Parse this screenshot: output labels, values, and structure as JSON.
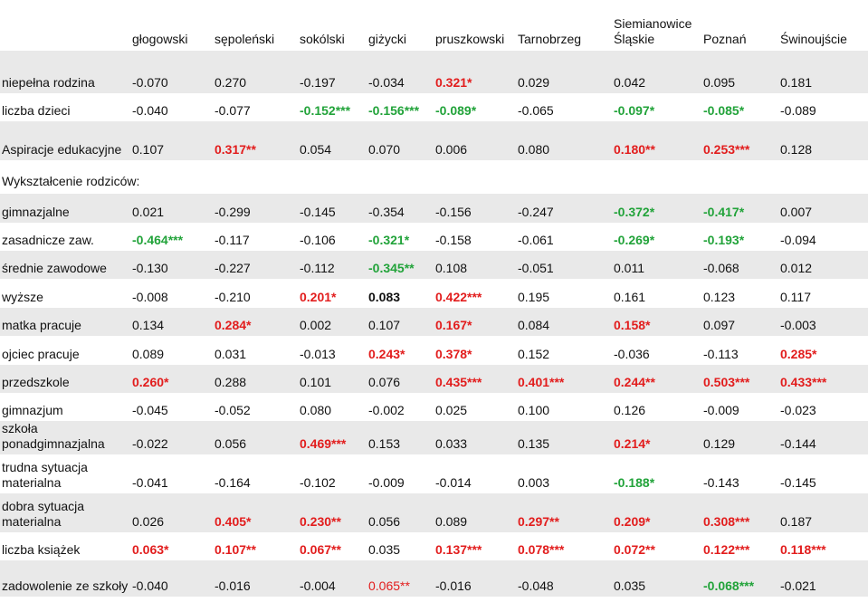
{
  "columns": [
    "",
    "głogowski",
    "sępoleński",
    "sokólski",
    "giżycki",
    "pruszkowski",
    "Tarnobrzeg",
    "Siemianowice Śląskie",
    "Poznań",
    "Świnoujście"
  ],
  "rows": [
    {
      "label": "niepełna rodzina",
      "cells": [
        {
          "v": "-0.070"
        },
        {
          "v": "0.270"
        },
        {
          "v": "-0.197"
        },
        {
          "v": "-0.034"
        },
        {
          "v": "0.321*",
          "s": "red"
        },
        {
          "v": "0.029"
        },
        {
          "v": "0.042"
        },
        {
          "v": "0.095"
        },
        {
          "v": "0.181"
        }
      ]
    },
    {
      "label": "liczba dzieci",
      "cells": [
        {
          "v": "-0.040"
        },
        {
          "v": "-0.077"
        },
        {
          "v": "-0.152***",
          "s": "green"
        },
        {
          "v": "-0.156***",
          "s": "green"
        },
        {
          "v": "-0.089*",
          "s": "green"
        },
        {
          "v": "-0.065"
        },
        {
          "v": "-0.097*",
          "s": "green"
        },
        {
          "v": "-0.085*",
          "s": "green"
        },
        {
          "v": "-0.089"
        }
      ]
    },
    {
      "label": "Aspiracje edukacyjne",
      "cells": [
        {
          "v": "0.107"
        },
        {
          "v": "0.317**",
          "s": "red"
        },
        {
          "v": "0.054"
        },
        {
          "v": "0.070"
        },
        {
          "v": "0.006"
        },
        {
          "v": "0.080"
        },
        {
          "v": "0.180**",
          "s": "red"
        },
        {
          "v": "0.253***",
          "s": "red"
        },
        {
          "v": "0.128"
        }
      ]
    },
    {
      "label": "Wykształcenie rodziców:",
      "cells": []
    },
    {
      "label": "gimnazjalne",
      "cells": [
        {
          "v": "0.021"
        },
        {
          "v": "-0.299"
        },
        {
          "v": "-0.145"
        },
        {
          "v": "-0.354"
        },
        {
          "v": "-0.156"
        },
        {
          "v": "-0.247"
        },
        {
          "v": "-0.372*",
          "s": "green"
        },
        {
          "v": "-0.417*",
          "s": "green"
        },
        {
          "v": "0.007"
        }
      ]
    },
    {
      "label": "zasadnicze zaw.",
      "cells": [
        {
          "v": "-0.464***",
          "s": "green"
        },
        {
          "v": "-0.117"
        },
        {
          "v": "-0.106"
        },
        {
          "v": "-0.321*",
          "s": "green"
        },
        {
          "v": "-0.158"
        },
        {
          "v": "-0.061"
        },
        {
          "v": "-0.269*",
          "s": "green"
        },
        {
          "v": "-0.193*",
          "s": "green"
        },
        {
          "v": "-0.094"
        }
      ]
    },
    {
      "label": "średnie zawodowe",
      "cells": [
        {
          "v": "-0.130"
        },
        {
          "v": "-0.227"
        },
        {
          "v": "-0.112"
        },
        {
          "v": "-0.345**",
          "s": "green"
        },
        {
          "v": "0.108"
        },
        {
          "v": "-0.051"
        },
        {
          "v": "0.011"
        },
        {
          "v": "-0.068"
        },
        {
          "v": "0.012"
        }
      ]
    },
    {
      "label": "wyższe",
      "cells": [
        {
          "v": "-0.008"
        },
        {
          "v": "-0.210"
        },
        {
          "v": "0.201*",
          "s": "red"
        },
        {
          "v": "0.083",
          "s": "bold"
        },
        {
          "v": "0.422***",
          "s": "red"
        },
        {
          "v": "0.195"
        },
        {
          "v": "0.161"
        },
        {
          "v": "0.123"
        },
        {
          "v": "0.117"
        }
      ]
    },
    {
      "label": "matka pracuje",
      "cells": [
        {
          "v": "0.134"
        },
        {
          "v": "0.284*",
          "s": "red"
        },
        {
          "v": "0.002"
        },
        {
          "v": "0.107"
        },
        {
          "v": "0.167*",
          "s": "red"
        },
        {
          "v": "0.084"
        },
        {
          "v": "0.158*",
          "s": "red"
        },
        {
          "v": "0.097"
        },
        {
          "v": "-0.003"
        }
      ]
    },
    {
      "label": "ojciec pracuje",
      "cells": [
        {
          "v": "0.089"
        },
        {
          "v": "0.031"
        },
        {
          "v": "-0.013"
        },
        {
          "v": "0.243*",
          "s": "red"
        },
        {
          "v": "0.378*",
          "s": "red"
        },
        {
          "v": "0.152"
        },
        {
          "v": "-0.036"
        },
        {
          "v": "-0.113"
        },
        {
          "v": "0.285*",
          "s": "red"
        }
      ]
    },
    {
      "label": "przedszkole",
      "cells": [
        {
          "v": "0.260*",
          "s": "red"
        },
        {
          "v": "0.288"
        },
        {
          "v": "0.101"
        },
        {
          "v": "0.076"
        },
        {
          "v": "0.435***",
          "s": "red"
        },
        {
          "v": "0.401***",
          "s": "red"
        },
        {
          "v": "0.244**",
          "s": "red"
        },
        {
          "v": "0.503***",
          "s": "red"
        },
        {
          "v": "0.433***",
          "s": "red"
        }
      ]
    },
    {
      "label": "gimnazjum",
      "cells": [
        {
          "v": "-0.045"
        },
        {
          "v": "-0.052"
        },
        {
          "v": "0.080"
        },
        {
          "v": "-0.002"
        },
        {
          "v": "0.025"
        },
        {
          "v": "0.100"
        },
        {
          "v": "0.126"
        },
        {
          "v": "-0.009"
        },
        {
          "v": "-0.023"
        }
      ]
    },
    {
      "label": "szkoła ponadgimnazjalna",
      "cells": [
        {
          "v": "-0.022"
        },
        {
          "v": "0.056"
        },
        {
          "v": "0.469***",
          "s": "red"
        },
        {
          "v": "0.153"
        },
        {
          "v": "0.033"
        },
        {
          "v": "0.135"
        },
        {
          "v": "0.214*",
          "s": "red"
        },
        {
          "v": "0.129"
        },
        {
          "v": "-0.144"
        }
      ]
    },
    {
      "label": "trudna sytuacja materialna",
      "cells": [
        {
          "v": "-0.041"
        },
        {
          "v": "-0.164"
        },
        {
          "v": "-0.102"
        },
        {
          "v": "-0.009"
        },
        {
          "v": "-0.014"
        },
        {
          "v": "0.003"
        },
        {
          "v": "-0.188*",
          "s": "green"
        },
        {
          "v": "-0.143"
        },
        {
          "v": "-0.145"
        }
      ]
    },
    {
      "label": "dobra sytuacja materialna",
      "cells": [
        {
          "v": "0.026"
        },
        {
          "v": "0.405*",
          "s": "red"
        },
        {
          "v": "0.230**",
          "s": "red"
        },
        {
          "v": "0.056"
        },
        {
          "v": "0.089"
        },
        {
          "v": "0.297**",
          "s": "red"
        },
        {
          "v": "0.209*",
          "s": "red"
        },
        {
          "v": "0.308***",
          "s": "red"
        },
        {
          "v": "0.187"
        }
      ]
    },
    {
      "label": "liczba książek",
      "cells": [
        {
          "v": "0.063*",
          "s": "red"
        },
        {
          "v": "0.107**",
          "s": "red"
        },
        {
          "v": "0.067**",
          "s": "red"
        },
        {
          "v": "0.035"
        },
        {
          "v": "0.137***",
          "s": "red"
        },
        {
          "v": "0.078***",
          "s": "red"
        },
        {
          "v": "0.072**",
          "s": "red"
        },
        {
          "v": "0.122***",
          "s": "red"
        },
        {
          "v": "0.118***",
          "s": "red"
        }
      ]
    },
    {
      "label": "zadowolenie ze szkoły",
      "cells": [
        {
          "v": "-0.040"
        },
        {
          "v": "-0.016"
        },
        {
          "v": "-0.004"
        },
        {
          "v": "0.065**",
          "s": "redn"
        },
        {
          "v": "-0.016"
        },
        {
          "v": "-0.048"
        },
        {
          "v": "0.035"
        },
        {
          "v": "-0.068***",
          "s": "green"
        },
        {
          "v": "-0.021"
        }
      ]
    }
  ]
}
